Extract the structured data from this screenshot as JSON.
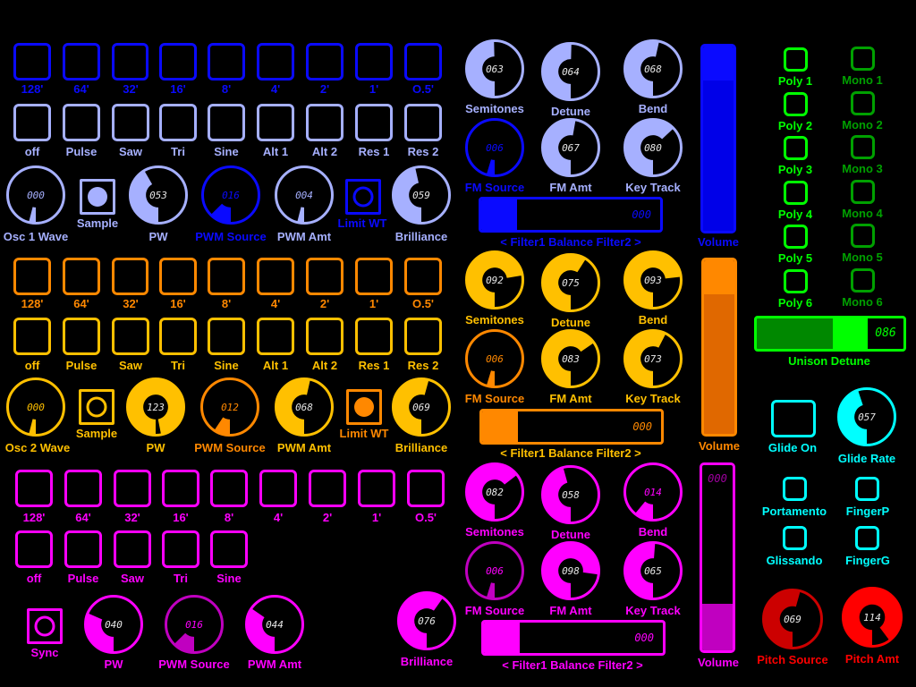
{
  "colors": {
    "osc1_octave": "#0a0aff",
    "osc1_main": "#a6b0ff",
    "osc2_octave": "#ff8800",
    "osc2_main": "#ffc000",
    "osc3": "#ff00ff",
    "osc3_dim": "#c000c0",
    "voice_poly": "#00ff00",
    "voice_mono": "#00a000",
    "glide": "#00ffff",
    "pitch_source": "#cc0000",
    "pitch_amt": "#ff0000"
  },
  "osc1": {
    "octaves": [
      "128'",
      "64'",
      "32'",
      "16'",
      "8'",
      "4'",
      "2'",
      "1'",
      "O.5'"
    ],
    "waves": [
      "off",
      "Pulse",
      "Saw",
      "Tri",
      "Sine",
      "Alt 1",
      "Alt 2",
      "Res 1",
      "Res 2"
    ],
    "wave_knob": {
      "label": "Osc 1 Wave",
      "value": "000",
      "fraction": 0
    },
    "sample": {
      "label": "Sample",
      "state": "on"
    },
    "pw": {
      "label": "PW",
      "value": "053",
      "fraction": 0.417
    },
    "pwm_source": {
      "label": "PWM Source",
      "value": "016",
      "fraction": 0.126
    },
    "pwm_amt": {
      "label": "PWM Amt",
      "value": "004",
      "fraction": 0.031
    },
    "limit_wt": {
      "label": "Limit WT",
      "state": "off"
    },
    "brilliance": {
      "label": "Brilliance",
      "value": "059",
      "fraction": 0.465
    },
    "semitones": {
      "label": "Semitones",
      "value": "063",
      "fraction": 0.496
    },
    "detune": {
      "label": "Detune",
      "value": "064",
      "fraction": 0.504
    },
    "bend": {
      "label": "Bend",
      "value": "068",
      "fraction": 0.535
    },
    "fm_source": {
      "label": "FM Source",
      "value": "006",
      "fraction": 0.047
    },
    "fm_amt": {
      "label": "FM Amt",
      "value": "067",
      "fraction": 0.528
    },
    "key_track": {
      "label": "Key Track",
      "value": "080",
      "fraction": 0.63
    },
    "balance": {
      "label": "< Filter1  Balance Filter2 >",
      "value": "000",
      "fraction": 0.2
    },
    "volume": {
      "label": "Volume",
      "fraction": 1.0
    }
  },
  "osc2": {
    "octaves": [
      "128'",
      "64'",
      "32'",
      "16'",
      "8'",
      "4'",
      "2'",
      "1'",
      "O.5'"
    ],
    "waves": [
      "off",
      "Pulse",
      "Saw",
      "Tri",
      "Sine",
      "Alt 1",
      "Alt 2",
      "Res 1",
      "Res 2"
    ],
    "wave_knob": {
      "label": "Osc 2 Wave",
      "value": "000",
      "fraction": 0
    },
    "sample": {
      "label": "Sample",
      "state": "off"
    },
    "pw": {
      "label": "PW",
      "value": "123",
      "fraction": 0.969
    },
    "pwm_source": {
      "label": "PWM Source",
      "value": "012",
      "fraction": 0.094
    },
    "pwm_amt": {
      "label": "PWM Amt",
      "value": "068",
      "fraction": 0.535
    },
    "limit_wt": {
      "label": "Limit WT",
      "state": "on"
    },
    "brilliance": {
      "label": "Brilliance",
      "value": "069",
      "fraction": 0.543
    },
    "semitones": {
      "label": "Semitones",
      "value": "092",
      "fraction": 0.724
    },
    "detune": {
      "label": "Detune",
      "value": "075",
      "fraction": 0.59
    },
    "bend": {
      "label": "Bend",
      "value": "093",
      "fraction": 0.732
    },
    "fm_source": {
      "label": "FM Source",
      "value": "006",
      "fraction": 0.047
    },
    "fm_amt": {
      "label": "FM Amt",
      "value": "083",
      "fraction": 0.654
    },
    "key_track": {
      "label": "Key Track",
      "value": "073",
      "fraction": 0.575
    },
    "balance": {
      "label": "< Filter1  Balance Filter2 >",
      "value": "000",
      "fraction": 0.2
    },
    "volume": {
      "label": "Volume",
      "fraction": 1.0
    }
  },
  "osc3": {
    "octaves": [
      "128'",
      "64'",
      "32'",
      "16'",
      "8'",
      "4'",
      "2'",
      "1'",
      "O.5'"
    ],
    "waves": [
      "off",
      "Pulse",
      "Saw",
      "Tri",
      "Sine"
    ],
    "sync": {
      "label": "Sync",
      "state": "off"
    },
    "pw": {
      "label": "PW",
      "value": "040",
      "fraction": 0.315
    },
    "pwm_source": {
      "label": "PWM Source",
      "value": "016",
      "fraction": 0.126
    },
    "pwm_amt": {
      "label": "PWM Amt",
      "value": "044",
      "fraction": 0.346
    },
    "brilliance": {
      "label": "Brilliance",
      "value": "076",
      "fraction": 0.598
    },
    "semitones": {
      "label": "Semitones",
      "value": "082",
      "fraction": 0.646
    },
    "detune": {
      "label": "Detune",
      "value": "058",
      "fraction": 0.457
    },
    "bend": {
      "label": "Bend",
      "value": "014",
      "fraction": 0.11
    },
    "fm_source": {
      "label": "FM Source",
      "value": "006",
      "fraction": 0.047
    },
    "fm_amt": {
      "label": "FM Amt",
      "value": "098",
      "fraction": 0.772
    },
    "key_track": {
      "label": "Key Track",
      "value": "065",
      "fraction": 0.512
    },
    "balance": {
      "label": "< Filter1  Balance Filter2 >",
      "value": "000",
      "fraction": 0.2
    },
    "volume": {
      "label": "Volume",
      "value": "000",
      "fraction": 0.25
    }
  },
  "voices": {
    "poly": [
      "Poly 1",
      "Poly 2",
      "Poly 3",
      "Poly 4",
      "Poly 5",
      "Poly 6"
    ],
    "mono": [
      "Mono 1",
      "Mono 2",
      "Mono 3",
      "Mono 4",
      "Mono 5",
      "Mono 6"
    ],
    "unison_detune": {
      "label": "Unison Detune",
      "value": "086",
      "fraction": 0.68
    }
  },
  "glide": {
    "glide_on": {
      "label": "Glide On"
    },
    "glide_rate": {
      "label": "Glide Rate",
      "value": "057",
      "fraction": 0.449
    },
    "portamento": {
      "label": "Portamento"
    },
    "finger_p": {
      "label": "FingerP"
    },
    "glissando": {
      "label": "Glissando"
    },
    "finger_g": {
      "label": "FingerG"
    }
  },
  "pitch": {
    "source": {
      "label": "Pitch Source",
      "value": "069",
      "fraction": 0.543
    },
    "amt": {
      "label": "Pitch Amt",
      "value": "114",
      "fraction": 0.898
    }
  }
}
